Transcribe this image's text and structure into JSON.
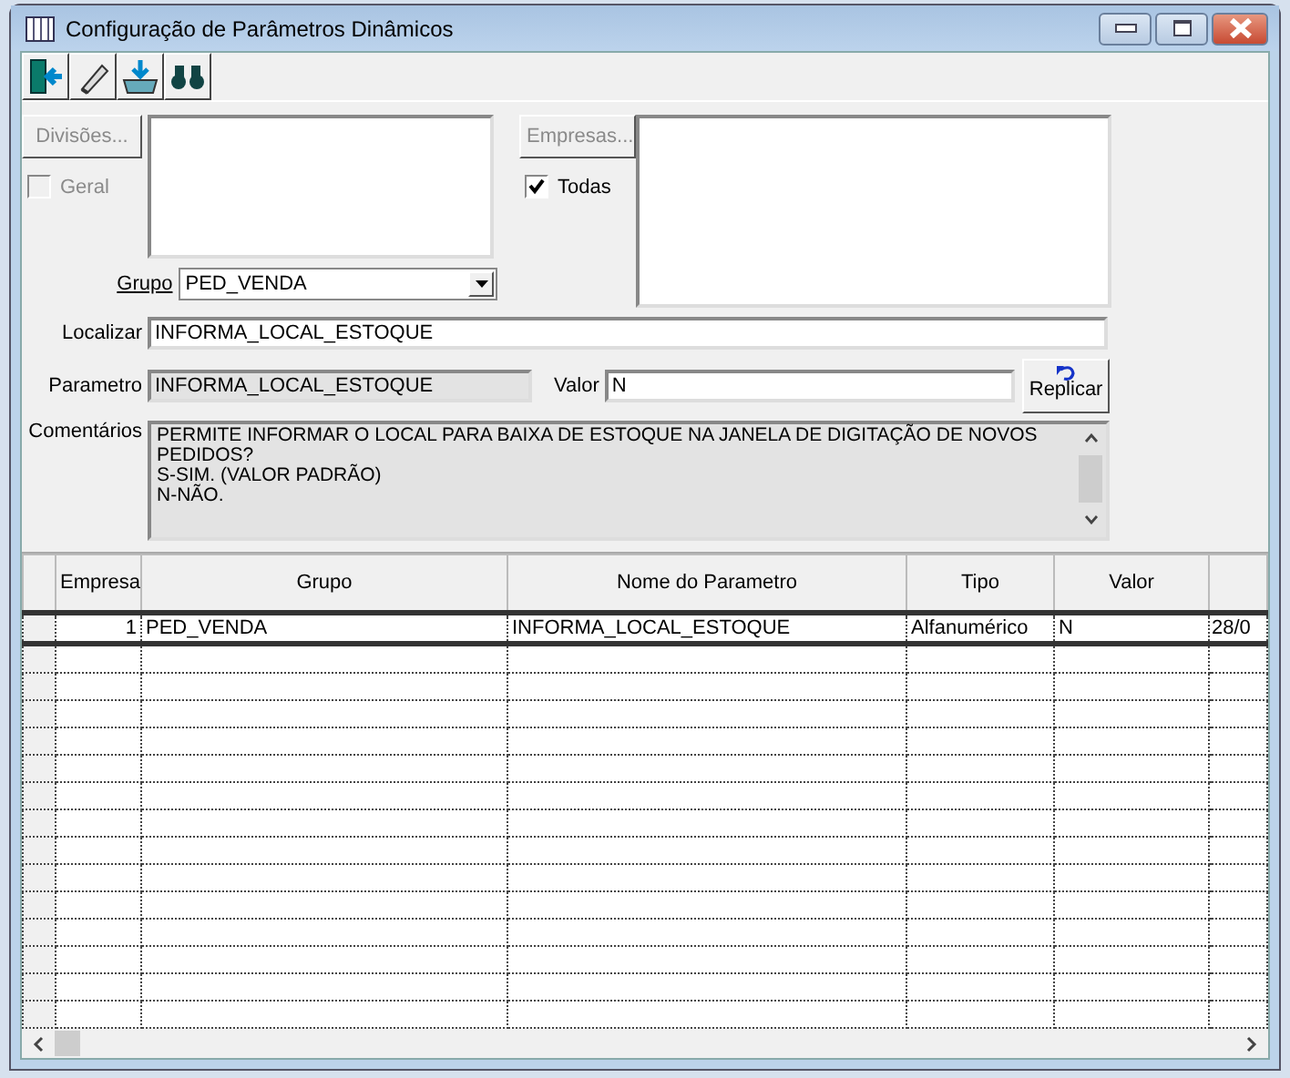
{
  "window": {
    "title": "Configuração de Parâmetros Dinâmicos"
  },
  "toolbar": [
    {
      "kind": "exit"
    },
    {
      "kind": "eraser"
    },
    {
      "kind": "tray"
    },
    {
      "kind": "binoculars"
    }
  ],
  "divisions": {
    "button": "Divisões...",
    "checkbox": {
      "label": "Geral",
      "checked": false,
      "disabled": true
    }
  },
  "companies": {
    "button": "Empresas...",
    "checkbox": {
      "label": "Todas",
      "checked": true,
      "disabled": false
    }
  },
  "group": {
    "label": "Grupo",
    "value": "PED_VENDA"
  },
  "search": {
    "label": "Localizar",
    "value": "INFORMA_LOCAL_ESTOQUE"
  },
  "parameter": {
    "label": "Parametro",
    "value": "INFORMA_LOCAL_ESTOQUE"
  },
  "value": {
    "label": "Valor",
    "value": "N"
  },
  "replicate_button": "Replicar",
  "comments": {
    "label": "Comentários",
    "lines": [
      "PERMITE INFORMAR O LOCAL PARA BAIXA DE ESTOQUE NA JANELA DE DIGITAÇÃO DE NOVOS PEDIDOS?",
      "S-SIM. (VALOR PADRÃO)",
      "N-NÃO."
    ]
  },
  "table": {
    "columns": [
      "Empresa",
      "Grupo",
      "Nome do Parametro",
      "Tipo",
      "Valor",
      ""
    ],
    "rows": [
      {
        "selected": true,
        "cells": [
          "1",
          "PED_VENDA",
          "INFORMA_LOCAL_ESTOQUE",
          "Alfanumérico",
          "N",
          "28/0"
        ]
      }
    ]
  }
}
